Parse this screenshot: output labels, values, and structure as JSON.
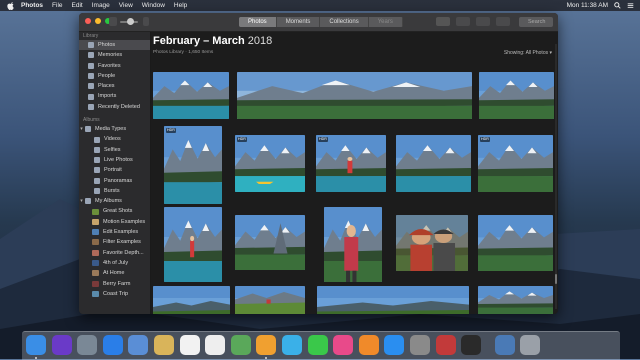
{
  "menubar": {
    "app_name": "Photos",
    "items": [
      "File",
      "Edit",
      "Image",
      "View",
      "Window",
      "Help"
    ],
    "clock": "Mon 11:38 AM"
  },
  "toolbar": {
    "tabs": [
      {
        "label": "Photos",
        "active": true
      },
      {
        "label": "Moments",
        "active": false
      },
      {
        "label": "Collections",
        "active": false
      },
      {
        "label": "Years",
        "active": false,
        "dim": true
      }
    ],
    "search_placeholder": "Search"
  },
  "sidebar": {
    "library_header": "Library",
    "library_items": [
      {
        "label": "Photos",
        "icon": "photos-icon",
        "selected": true
      },
      {
        "label": "Memories",
        "icon": "memories-icon"
      },
      {
        "label": "Favorites",
        "icon": "heart-icon"
      },
      {
        "label": "People",
        "icon": "person-icon"
      },
      {
        "label": "Places",
        "icon": "pin-icon"
      },
      {
        "label": "Imports",
        "icon": "clock-icon"
      },
      {
        "label": "Recently Deleted",
        "icon": "trash-icon"
      }
    ],
    "albums_header": "Albums",
    "media_types_label": "Media Types",
    "media_types": [
      {
        "label": "Videos",
        "icon": "video-icon"
      },
      {
        "label": "Selfies",
        "icon": "selfie-icon"
      },
      {
        "label": "Live Photos",
        "icon": "live-photo-icon"
      },
      {
        "label": "Portrait",
        "icon": "portrait-icon"
      },
      {
        "label": "Panoramas",
        "icon": "panorama-icon"
      },
      {
        "label": "Bursts",
        "icon": "burst-icon"
      }
    ],
    "my_albums_label": "My Albums",
    "my_albums": [
      {
        "label": "Great Shots",
        "color": "#6b8f3a"
      },
      {
        "label": "Motion Examples",
        "color": "#c7a46a"
      },
      {
        "label": "Edit Examples",
        "color": "#4f7fb4"
      },
      {
        "label": "Filter Examples",
        "color": "#8a6a4a"
      },
      {
        "label": "Favorite Depth...",
        "color": "#b06a5a"
      },
      {
        "label": "4th of July",
        "color": "#3a5a8a"
      },
      {
        "label": "At Home",
        "color": "#9a7a5a"
      },
      {
        "label": "Berry Farm",
        "color": "#7a3a3a"
      },
      {
        "label": "Coast Trip",
        "color": "#5a8aaa"
      }
    ]
  },
  "main": {
    "title_bold": "February – March",
    "title_year": "2018",
    "subtitle": "Photos Library · 1,650 Items",
    "showing_label": "Showing: All Photos ▾",
    "hdr_badge": "HDR"
  },
  "colors": {
    "window_bg": "#1e1e1e",
    "sidebar_bg": "#2b2b2d",
    "selection": "#4a4a4e"
  },
  "dock": {
    "apps": [
      "Finder",
      "Siri",
      "Launchpad",
      "Safari",
      "Mail",
      "Notes",
      "Calendar",
      "Reminders",
      "Maps",
      "Photos",
      "Messages",
      "FaceTime",
      "iTunes",
      "iBooks",
      "App Store",
      "System Preferences",
      "Photo Booth",
      "Terminal",
      "Downloads",
      "Trash"
    ]
  }
}
